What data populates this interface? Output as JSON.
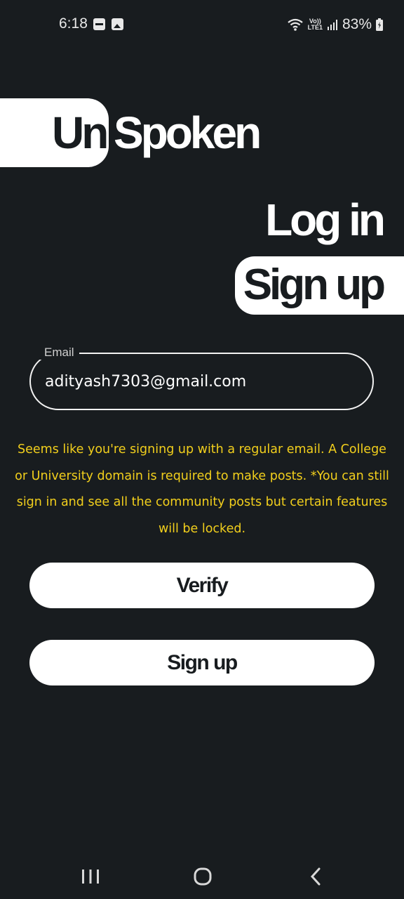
{
  "status_bar": {
    "time": "6:18",
    "notification_icons": [
      "paytm-icon",
      "gallery-icon"
    ],
    "network_label_top": "Vo))",
    "network_label_bottom": "LTE1",
    "battery": "83%"
  },
  "logo": {
    "part1": "Un",
    "part2": "Spoken"
  },
  "tabs": {
    "login": "Log in",
    "signup": "Sign up",
    "active": "signup"
  },
  "email": {
    "label": "Email",
    "value": "adityash7303@gmail.com"
  },
  "notice": {
    "text": "Seems like you're signing up with a regular email. A College or University domain is required to make posts. *You can still sign in and see all the community posts but certain features will be locked."
  },
  "buttons": {
    "verify": "Verify",
    "signup": "Sign up"
  },
  "colors": {
    "background": "#181c1f",
    "primary": "#ffffff",
    "notice": "#f2cf1c"
  }
}
